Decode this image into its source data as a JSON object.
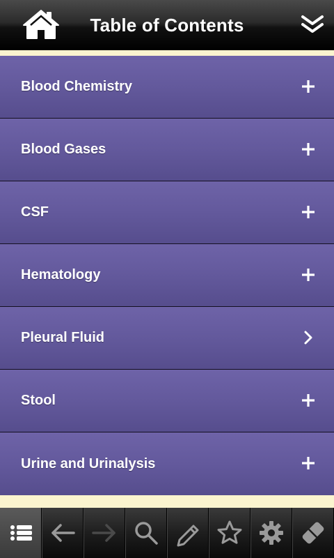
{
  "header": {
    "title": "Table of Contents"
  },
  "toc": {
    "items": [
      {
        "label": "Blood Chemistry",
        "control": "plus-icon"
      },
      {
        "label": "Blood Gases",
        "control": "plus-icon"
      },
      {
        "label": "CSF",
        "control": "plus-icon"
      },
      {
        "label": "Hematology",
        "control": "plus-icon"
      },
      {
        "label": "Pleural Fluid",
        "control": "chevron-right-icon"
      },
      {
        "label": "Stool",
        "control": "plus-icon"
      },
      {
        "label": "Urine and Urinalysis",
        "control": "plus-icon"
      }
    ]
  },
  "toolbar": {
    "icons": [
      "list-icon",
      "back-arrow-icon",
      "forward-arrow-icon",
      "search-icon",
      "pencil-icon",
      "star-icon",
      "gear-icon",
      "eraser-icon"
    ]
  },
  "colors": {
    "row": "#63599c",
    "cream": "#fbf4cf",
    "header": "#000000"
  }
}
